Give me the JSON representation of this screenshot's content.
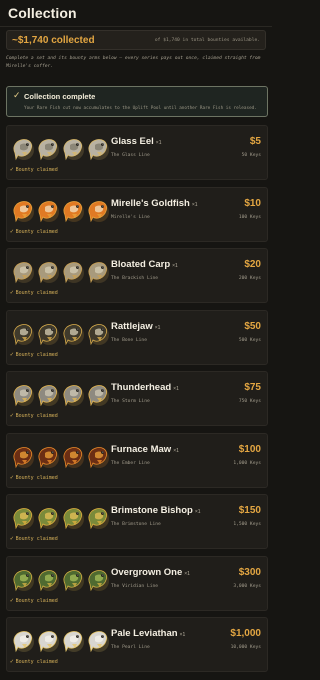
{
  "header": {
    "title": "Collection"
  },
  "summary": {
    "collected": "~$1,740 collected",
    "total": "of $1,740 in total bounties available."
  },
  "intro": "Complete a set and its bounty arms below — every series pays out once, claimed straight from Mirelle's coffer.",
  "complete_banner": {
    "check": "✓",
    "title": "Collection complete",
    "desc": "Your Rare Fish cut now accumulates to the Uplift Pool until another Rare Fish is released."
  },
  "claimed_label": "Bounty claimed",
  "cards": [
    {
      "name": "Glass Eel",
      "mult": "×1",
      "line": "The Glass Line",
      "price": "$5",
      "keys": "50 Keys",
      "colors": {
        "body": "#b9b2a2",
        "accent": "#7e786a",
        "glow": "#d8b86a"
      }
    },
    {
      "name": "Mirelle's Goldfish",
      "mult": "×1",
      "line": "Mirelle's Line",
      "price": "$10",
      "keys": "100 Keys",
      "colors": {
        "body": "#e07a24",
        "accent": "#f3e2c2",
        "glow": "#e8a23a"
      }
    },
    {
      "name": "Bloated Carp",
      "mult": "×1",
      "line": "The Brackish Line",
      "price": "$20",
      "keys": "200 Keys",
      "colors": {
        "body": "#a89a7c",
        "accent": "#d6cdb6",
        "glow": "#c9a052"
      }
    },
    {
      "name": "Rattlejaw",
      "mult": "×1",
      "line": "The Bone Line",
      "price": "$50",
      "keys": "500 Keys",
      "colors": {
        "body": "#3f3a2c",
        "accent": "#d7cfb4",
        "glow": "#d8ac4c"
      }
    },
    {
      "name": "Thunderhead",
      "mult": "×1",
      "line": "The Storm Line",
      "price": "$75",
      "keys": "750 Keys",
      "colors": {
        "body": "#8e8a80",
        "accent": "#cfc8b6",
        "glow": "#e4b650"
      }
    },
    {
      "name": "Furnace Maw",
      "mult": "×1",
      "line": "The Ember Line",
      "price": "$100",
      "keys": "1,000 Keys",
      "colors": {
        "body": "#6b2e14",
        "accent": "#f0a43a",
        "glow": "#e88a2a"
      }
    },
    {
      "name": "Brimstone Bishop",
      "mult": "×1",
      "line": "The Brimstone Line",
      "price": "$150",
      "keys": "1,500 Keys",
      "colors": {
        "body": "#7a8a3a",
        "accent": "#e8c058",
        "glow": "#dcae3e"
      }
    },
    {
      "name": "Overgrown One",
      "mult": "×1",
      "line": "The Viridian Line",
      "price": "$300",
      "keys": "3,000 Keys",
      "colors": {
        "body": "#4f6a30",
        "accent": "#a7c05a",
        "glow": "#cfae44"
      }
    },
    {
      "name": "Pale Leviathan",
      "mult": "×1",
      "line": "The Pearl Line",
      "price": "$1,000",
      "keys": "10,000 Keys",
      "colors": {
        "body": "#d8d6d0",
        "accent": "#f5f3ee",
        "glow": "#e6c66a"
      }
    }
  ]
}
